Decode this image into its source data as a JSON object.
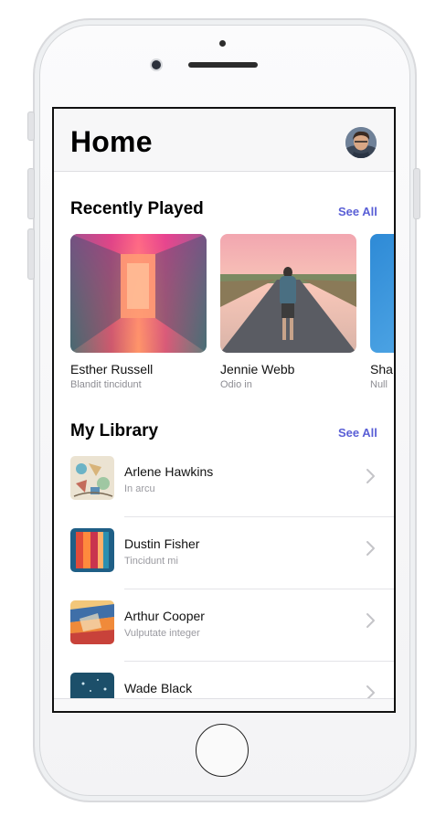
{
  "header": {
    "title": "Home"
  },
  "recently_played": {
    "title": "Recently Played",
    "see_all": "See All",
    "items": [
      {
        "name": "Esther Russell",
        "subtitle": "Blandit tincidunt"
      },
      {
        "name": "Jennie Webb",
        "subtitle": "Odio in"
      },
      {
        "name": "Sha",
        "subtitle": "Null"
      }
    ]
  },
  "my_library": {
    "title": "My Library",
    "see_all": "See All",
    "items": [
      {
        "title": "Arlene Hawkins",
        "subtitle": "In arcu"
      },
      {
        "title": "Dustin Fisher",
        "subtitle": "Tincidunt mi"
      },
      {
        "title": "Arthur Cooper",
        "subtitle": "Vulputate integer"
      },
      {
        "title": "Wade Black",
        "subtitle": ""
      }
    ]
  },
  "colors": {
    "accent": "#5a5fd6",
    "title": "#000000",
    "secondary": "#8d8d93"
  }
}
